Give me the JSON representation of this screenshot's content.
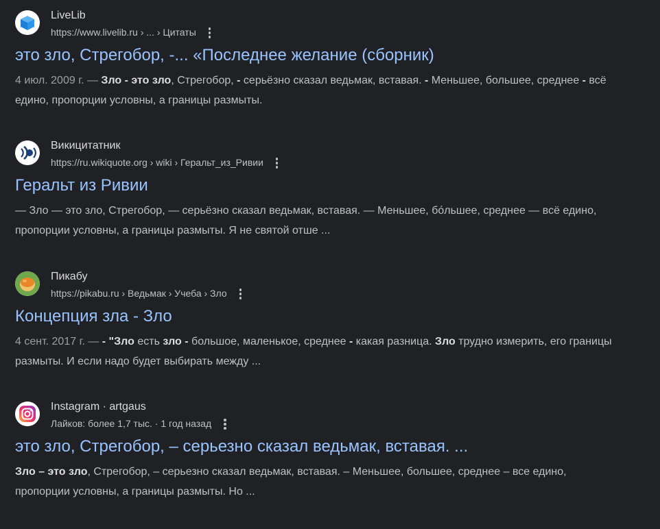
{
  "colors": {
    "background": "#202124",
    "link": "#99c3ff",
    "text": "#bdc1c6",
    "site_name": "#dadce0",
    "date": "#9aa0a6"
  },
  "results": [
    {
      "icon": "livelib-logo-icon",
      "site_name": "LiveLib",
      "url": "https://www.livelib.ru › ... › Цитаты",
      "title": "это зло, Стрегобор, -... «Последнее желание (сборник)",
      "date": "4 июл. 2009 г. — ",
      "snippet_parts": [
        {
          "t": "Зло - это зло",
          "b": true
        },
        {
          "t": ", Стрегобор, ",
          "b": false
        },
        {
          "t": "-",
          "b": true
        },
        {
          "t": " серьёзно сказал ведьмак, вставая. ",
          "b": false
        },
        {
          "t": "-",
          "b": true
        },
        {
          "t": " Меньшее, большее, среднее ",
          "b": false
        },
        {
          "t": "-",
          "b": true
        },
        {
          "t": " всё едино, пропорции условны, а границы размыты.",
          "b": false
        }
      ]
    },
    {
      "icon": "wikiquote-logo-icon",
      "site_name": "Викицитатник",
      "url": "https://ru.wikiquote.org › wiki › Геральт_из_Ривии",
      "title": "Геральт из Ривии",
      "date": "",
      "snippet_parts": [
        {
          "t": "— Зло — это зло, Стрегобор, — серьёзно сказал ведьмак, вставая. — Меньшее, бо́льшее, среднее — всё едино, пропорции условны, а границы размыты. Я не святой отше ...",
          "b": false
        }
      ]
    },
    {
      "icon": "pikabu-logo-icon",
      "site_name": "Пикабу",
      "url": "https://pikabu.ru › Ведьмак › Учеба › Зло",
      "title": "Концепция зла - Зло",
      "date": "4 сент. 2017 г. — ",
      "snippet_parts": [
        {
          "t": "- \"Зло",
          "b": true
        },
        {
          "t": " есть ",
          "b": false
        },
        {
          "t": "зло",
          "b": true
        },
        {
          "t": " ",
          "b": false
        },
        {
          "t": "-",
          "b": true
        },
        {
          "t": " большое, маленькое, среднее ",
          "b": false
        },
        {
          "t": "-",
          "b": true
        },
        {
          "t": " какая разница. ",
          "b": false
        },
        {
          "t": "Зло",
          "b": true
        },
        {
          "t": " трудно измерить, его границы размыты. И если надо будет выбирать между ...",
          "b": false
        }
      ]
    },
    {
      "icon": "instagram-logo-icon",
      "site_name": "Instagram · artgaus",
      "url": "Лайков: более 1,7 тыс. · 1 год назад",
      "title": "это зло, Стрегобор, – серьезно сказал ведьмак, вставая. ...",
      "date": "",
      "snippet_parts": [
        {
          "t": "Зло – это зло",
          "b": true
        },
        {
          "t": ", Стрегобор, – серьезно сказал ведьмак, вставая. – Меньшее, большее, среднее – все едино, пропорции условны, а границы размыты. Но ...",
          "b": false
        }
      ]
    }
  ]
}
